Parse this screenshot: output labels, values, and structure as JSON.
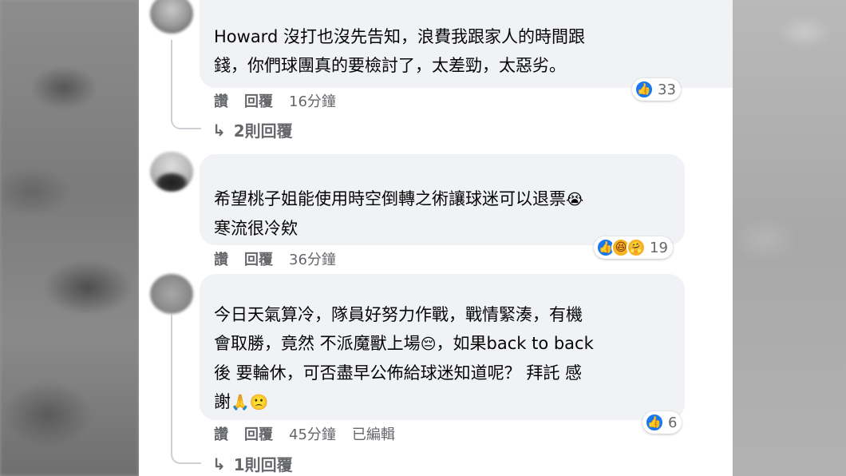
{
  "comments": [
    {
      "text_lines": [
        "Howard 沒打也沒先告知，浪費我跟家人的時間跟",
        "錢，你們球團真的要檢討了，太差勁，太惡劣。"
      ],
      "reaction_count": "33",
      "reaction_icons": [
        "like-icon"
      ],
      "actions": {
        "like": "讚",
        "reply": "回覆",
        "time": "16分鐘"
      },
      "replies_label": "2則回覆"
    },
    {
      "text_lines": [
        "希望桃子姐能使用時空倒轉之術讓球迷可以退票",
        "寒流很冷欸"
      ],
      "inline_emoji": "😭",
      "reaction_count": "19",
      "reaction_icons": [
        "like-icon",
        "haha-icon",
        "care-icon"
      ],
      "actions": {
        "like": "讚",
        "reply": "回覆",
        "time": "36分鐘"
      }
    },
    {
      "text_lines": [
        "今日天氣算冷，隊員好努力作戰，戰情緊湊，有機",
        "會取勝，竟然 不派魔獸上場",
        "，如果back to back",
        "後 要輪休，可否盡早公佈給球迷知道呢？ 拜託 感",
        "謝"
      ],
      "inline_emojis": [
        "😔",
        "🙏",
        "🙁"
      ],
      "reaction_count": "6",
      "reaction_icons": [
        "like-icon"
      ],
      "actions": {
        "like": "讚",
        "reply": "回覆",
        "time": "45分鐘",
        "edited": "已編輯"
      },
      "replies_label": "1則回覆"
    }
  ],
  "colors": {
    "bubble": "#f0f2f5",
    "meta_text": "#65676b",
    "like_blue": "#1877f2"
  },
  "icons": {
    "reply_arrow": "↳",
    "like": "👍"
  }
}
